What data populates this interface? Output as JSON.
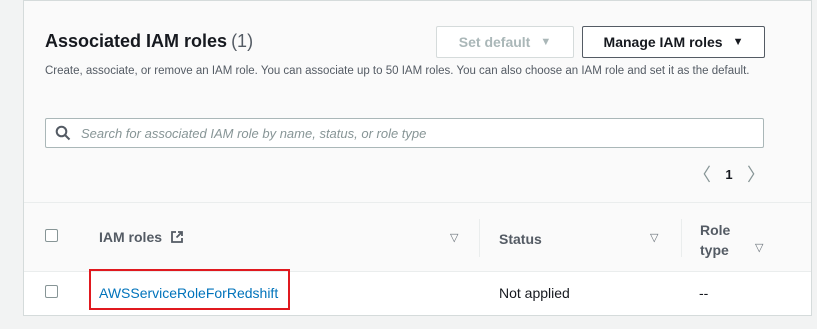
{
  "header": {
    "title": "Associated IAM roles",
    "count": "(1)",
    "description": "Create, associate, or remove an IAM role. You can associate up to 50 IAM roles. You can also choose an IAM role and set it as the default.",
    "set_default_label": "Set default",
    "manage_label": "Manage IAM roles"
  },
  "search": {
    "placeholder": "Search for associated IAM role by name, status, or role type"
  },
  "pagination": {
    "current_page": "1"
  },
  "table": {
    "columns": [
      {
        "label": "IAM roles"
      },
      {
        "label": "Status"
      },
      {
        "label_line1": "Role",
        "label_line2": "type"
      }
    ],
    "rows": [
      {
        "role": "AWSServiceRoleForRedshift",
        "status": "Not applied",
        "role_type": "--"
      }
    ]
  },
  "colors": {
    "link": "#0073bb",
    "highlight": "#e0191f"
  }
}
